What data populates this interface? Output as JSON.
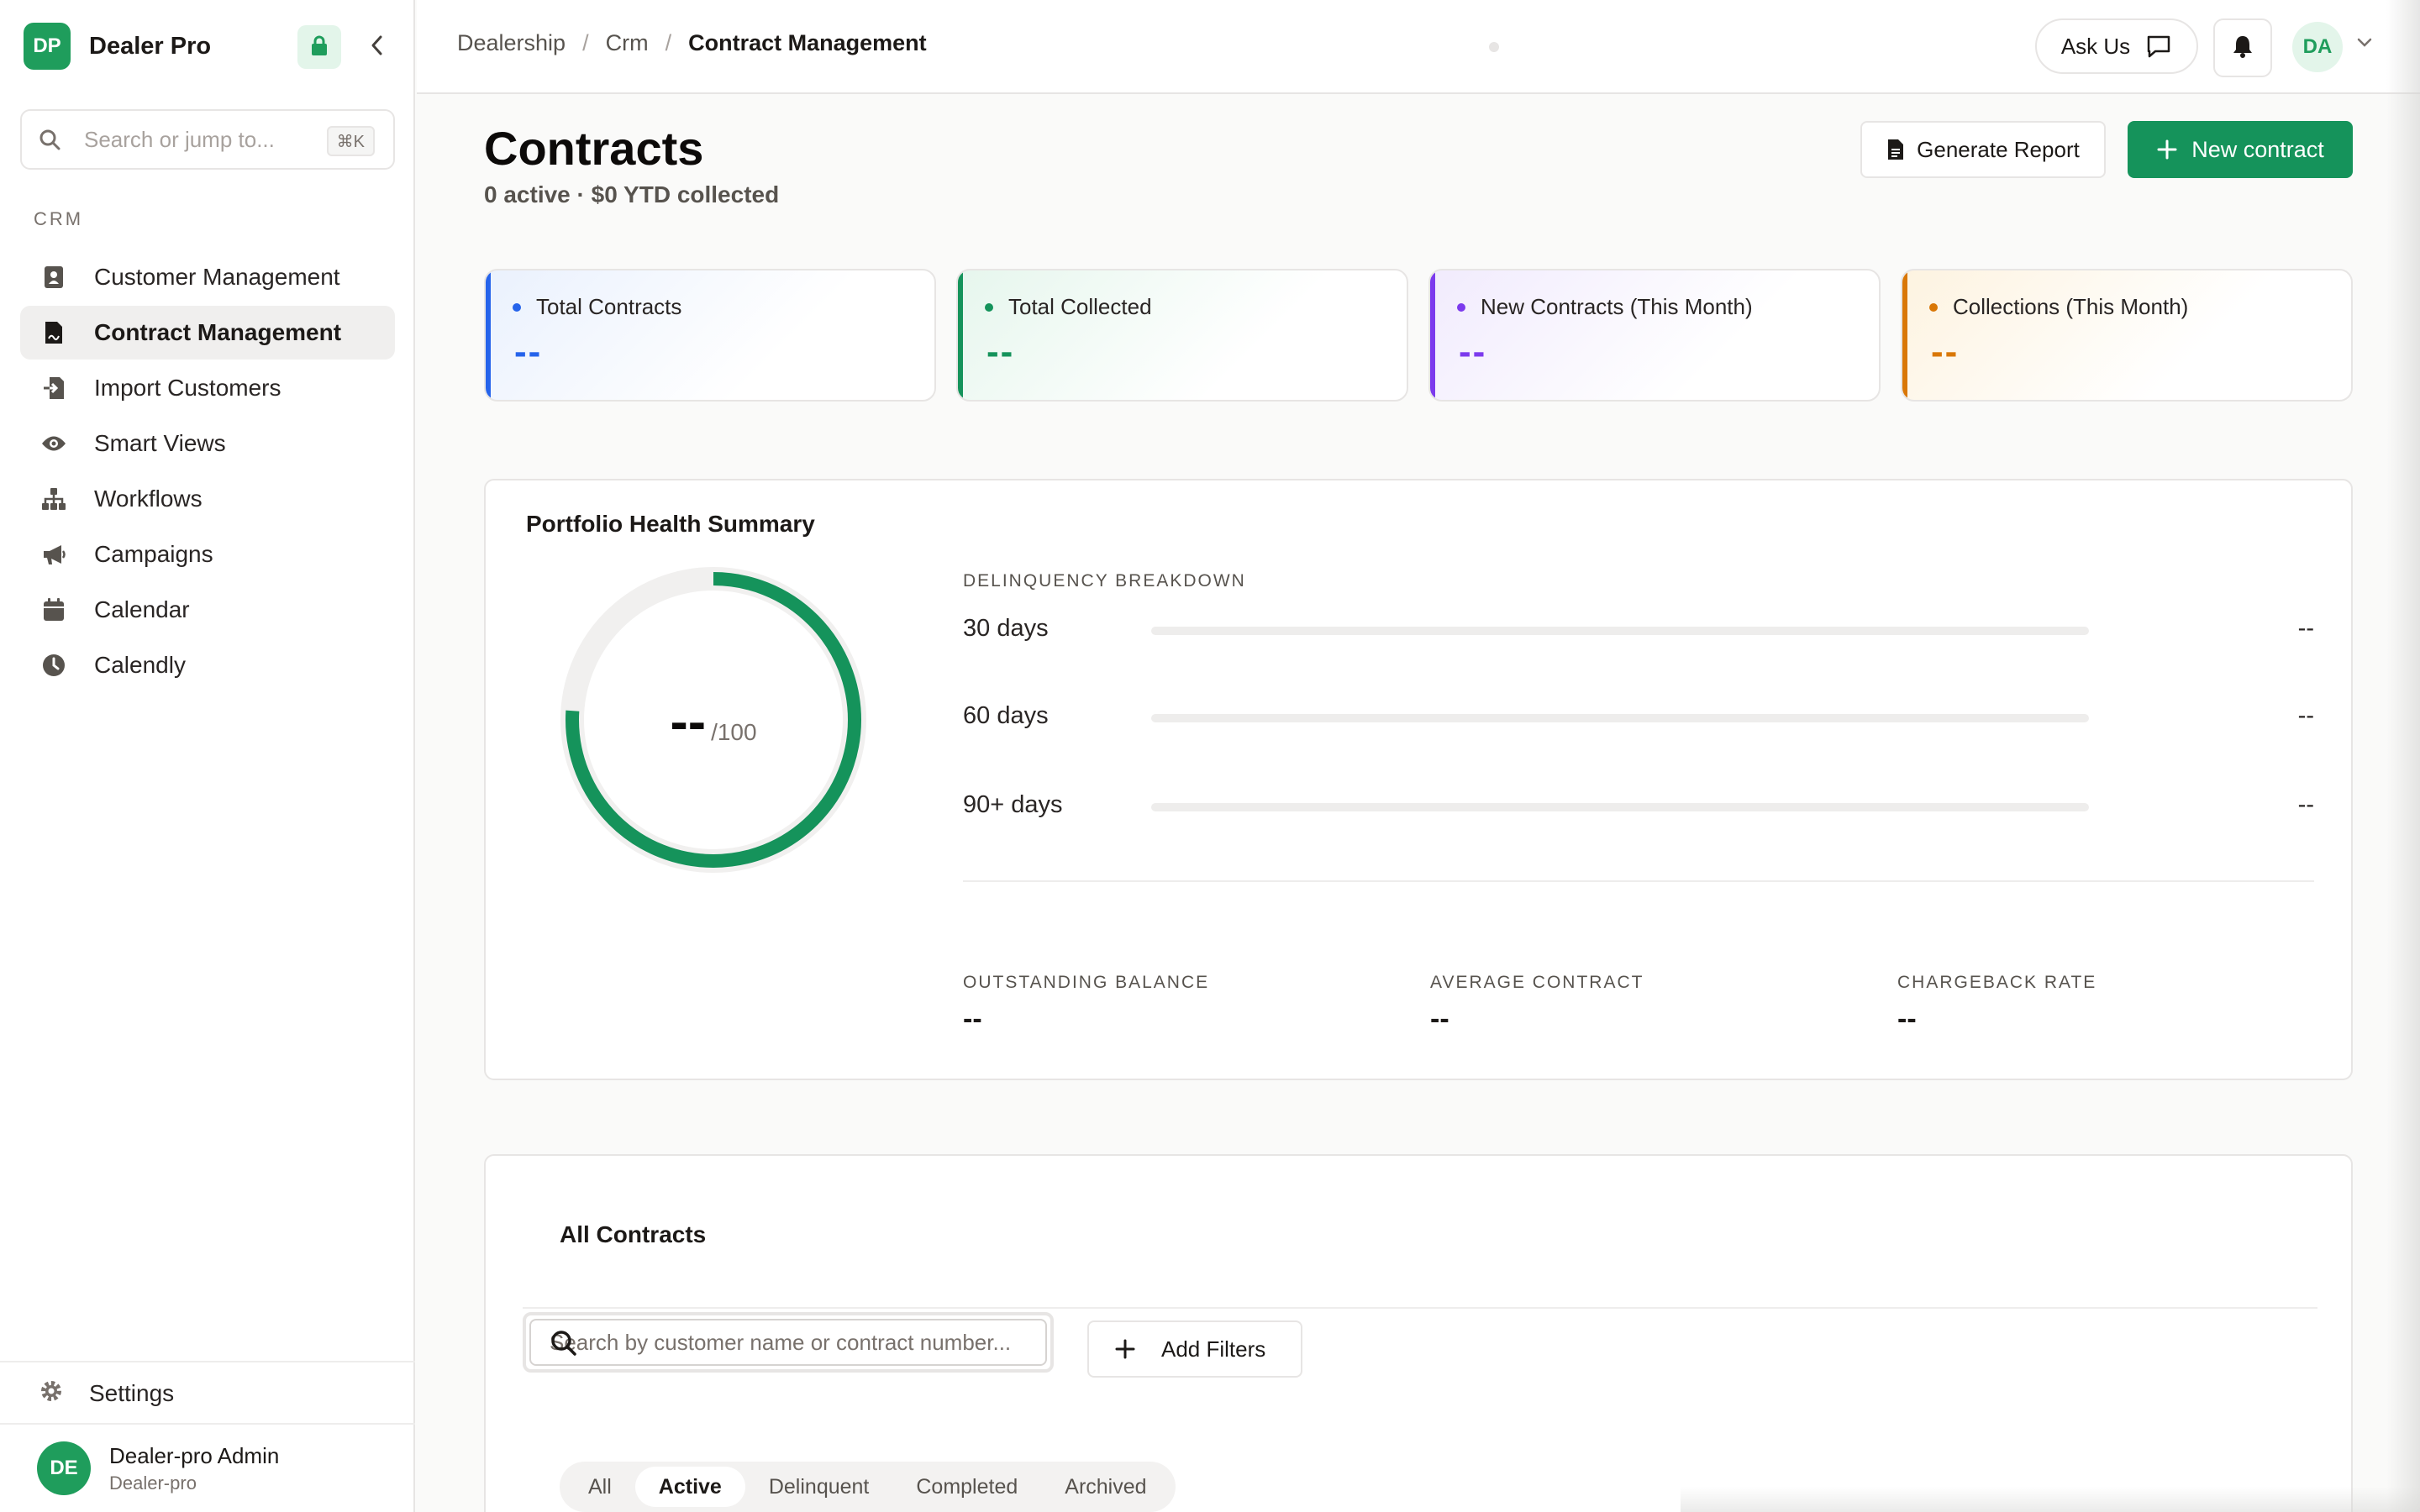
{
  "app": {
    "logo_text": "DP",
    "name": "Dealer Pro"
  },
  "sidebar": {
    "search_placeholder": "Search or jump to...",
    "search_shortcut": "⌘K",
    "section_label": "CRM",
    "items": [
      {
        "label": "Customer Management",
        "icon": "contacts-icon",
        "active": false
      },
      {
        "label": "Contract Management",
        "icon": "contract-icon",
        "active": true
      },
      {
        "label": "Import Customers",
        "icon": "import-icon",
        "active": false
      },
      {
        "label": "Smart Views",
        "icon": "eye-icon",
        "active": false
      },
      {
        "label": "Workflows",
        "icon": "workflow-icon",
        "active": false
      },
      {
        "label": "Campaigns",
        "icon": "megaphone-icon",
        "active": false
      },
      {
        "label": "Calendar",
        "icon": "calendar-icon",
        "active": false
      },
      {
        "label": "Calendly",
        "icon": "clock-icon",
        "active": false
      }
    ],
    "settings_label": "Settings",
    "user": {
      "initials": "DE",
      "name": "Dealer-pro Admin",
      "org": "Dealer-pro"
    }
  },
  "topbar": {
    "breadcrumb": [
      "Dealership",
      "Crm",
      "Contract Management"
    ],
    "ask_label": "Ask Us",
    "avatar_initials": "DA"
  },
  "page": {
    "title": "Contracts",
    "subtitle": "0 active · $0 YTD collected",
    "generate_report_label": "Generate Report",
    "new_contract_label": "New contract"
  },
  "stats": [
    {
      "label": "Total Contracts",
      "value": "--",
      "color": "#2563eb",
      "tint": "#eaf1fd"
    },
    {
      "label": "Total Collected",
      "value": "--",
      "color": "#15935b",
      "tint": "#e6f6ed"
    },
    {
      "label": "New Contracts (This Month)",
      "value": "--",
      "color": "#7c3aed",
      "tint": "#f1ebfd"
    },
    {
      "label": "Collections (This Month)",
      "value": "--",
      "color": "#d97706",
      "tint": "#fdf3e0"
    }
  ],
  "portfolio": {
    "title": "Portfolio Health Summary",
    "score": "--",
    "score_max": "/100",
    "score_fill": 0.76,
    "breakdown_title": "DELINQUENCY BREAKDOWN",
    "breakdown": [
      {
        "label": "30 days",
        "value": "--",
        "fill": 0
      },
      {
        "label": "60 days",
        "value": "--",
        "fill": 0
      },
      {
        "label": "90+ days",
        "value": "--",
        "fill": 0
      }
    ],
    "metrics": [
      {
        "label": "OUTSTANDING BALANCE",
        "value": "--"
      },
      {
        "label": "AVERAGE CONTRACT",
        "value": "--"
      },
      {
        "label": "CHARGEBACK RATE",
        "value": "--"
      }
    ]
  },
  "contracts": {
    "title": "All Contracts",
    "search_placeholder": "Search by customer name or contract number...",
    "add_filters_label": "Add Filters",
    "tabs": [
      {
        "label": "All",
        "active": false
      },
      {
        "label": "Active",
        "active": true
      },
      {
        "label": "Delinquent",
        "active": false
      },
      {
        "label": "Completed",
        "active": false
      },
      {
        "label": "Archived",
        "active": false
      }
    ]
  },
  "colors": {
    "brand": "#15935b",
    "accent_light": "#e3f5ea"
  }
}
